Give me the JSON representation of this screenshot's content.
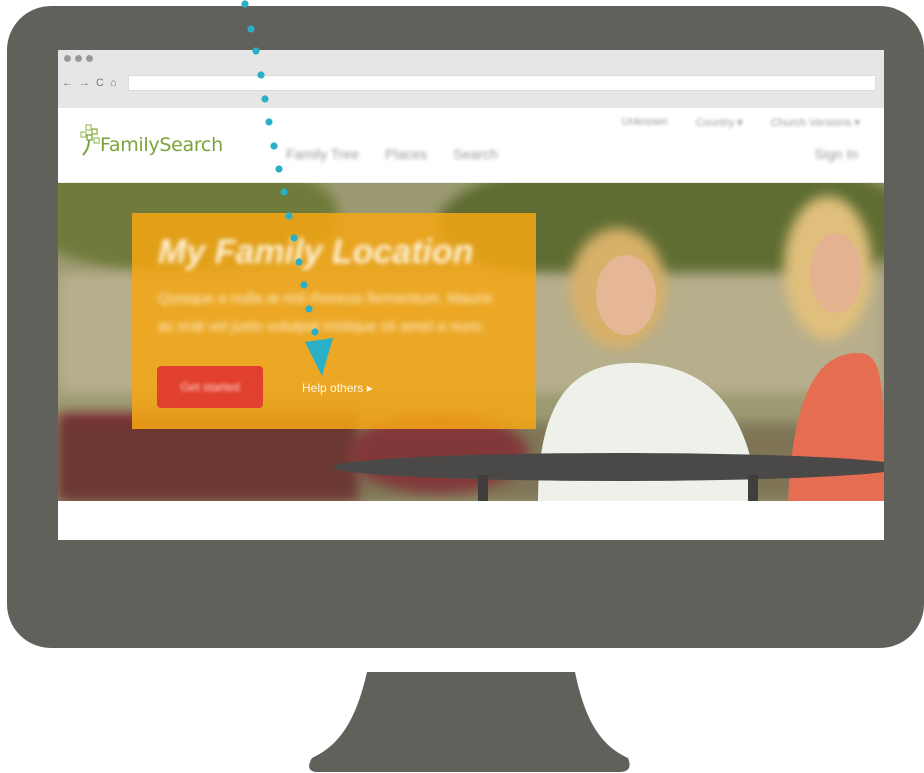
{
  "browser": {
    "nav_icons": [
      "←",
      "→",
      "C",
      "⌂"
    ],
    "url": ""
  },
  "site": {
    "logo_text": "FamilySearch",
    "util_nav": [
      "Unknown",
      "Country ▾",
      "Church Versions ▾"
    ],
    "main_nav": [
      "Family Tree",
      "Places",
      "Search"
    ],
    "sign_in": "Sign In"
  },
  "hero": {
    "title": "My Family Location",
    "body": "Quisque a nulla at nisl rhoncus fermentum. Mauris ac erat vel justo volutpat tristique sit amet a nunc.",
    "cta_label": "Get started",
    "help_link": "Help others ▸"
  },
  "colors": {
    "monitor": "#61615c",
    "brand_green": "#7aa33a",
    "panel_orange": "#f4a614",
    "cta_red": "#e2402e",
    "annotation_teal": "#2ab0c6"
  }
}
